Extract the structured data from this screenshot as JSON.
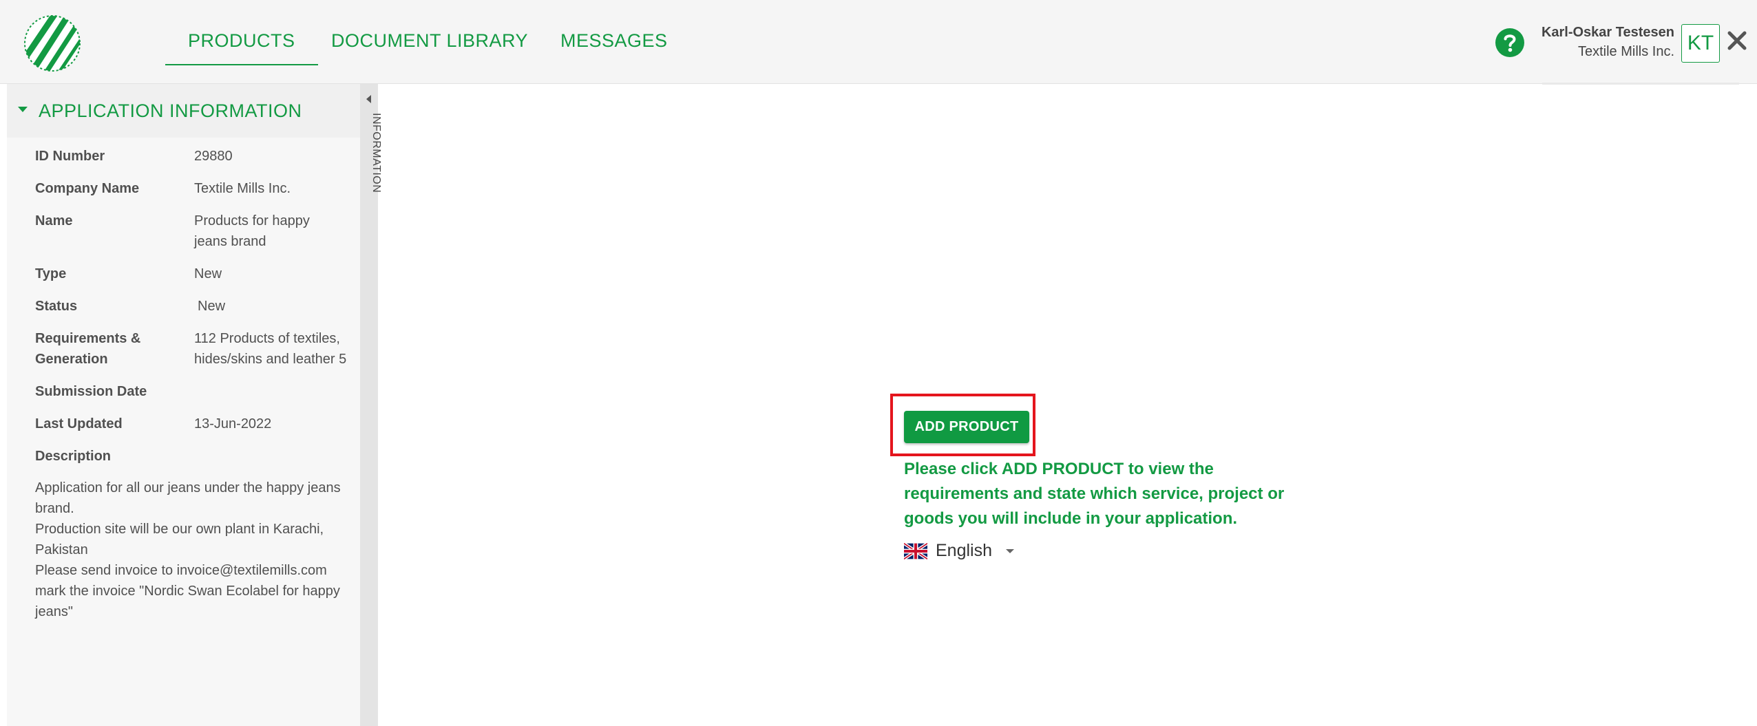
{
  "nav": {
    "tabs": [
      {
        "label": "PRODUCTS",
        "active": true
      },
      {
        "label": "DOCUMENT LIBRARY",
        "active": false
      },
      {
        "label": "MESSAGES",
        "active": false
      }
    ]
  },
  "user": {
    "name": "Karl-Oskar Testesen",
    "company": "Textile Mills Inc.",
    "initials": "KT"
  },
  "icons": {
    "logo": "swan-logo-icon",
    "help": "help-icon",
    "close": "close-icon",
    "flag": "uk-flag-icon"
  },
  "sidebar": {
    "title": "APPLICATION INFORMATION",
    "rail_label": "INFORMATION",
    "fields": [
      {
        "label": "ID Number",
        "value": "29880"
      },
      {
        "label": "Company Name",
        "value": "Textile Mills Inc."
      },
      {
        "label": "Name",
        "value": "Products for happy jeans brand"
      },
      {
        "label": "Type",
        "value": "New"
      },
      {
        "label": "Status",
        "value": "New"
      },
      {
        "label": "Requirements & Generation",
        "value": "112 Products of textiles, hides/skins and leather 5"
      },
      {
        "label": "Submission Date",
        "value": ""
      },
      {
        "label": "Last Updated",
        "value": "13-Jun-2022"
      },
      {
        "label": "Description",
        "value": ""
      }
    ],
    "description": [
      "Application for all our jeans under the happy jeans brand.",
      "Production site will be our own plant in Karachi, Pakistan",
      "Please send invoice to invoice@textilemills.com mark the invoice \"Nordic Swan Ecolabel for happy jeans\""
    ]
  },
  "main": {
    "add_button_label": "ADD PRODUCT",
    "instruction": "Please click ADD PRODUCT to view the requirements and state which service, project or goods you will include in your application.",
    "language": "English"
  },
  "colors": {
    "brand_green": "#139a43",
    "highlight_red": "#e4151d"
  }
}
